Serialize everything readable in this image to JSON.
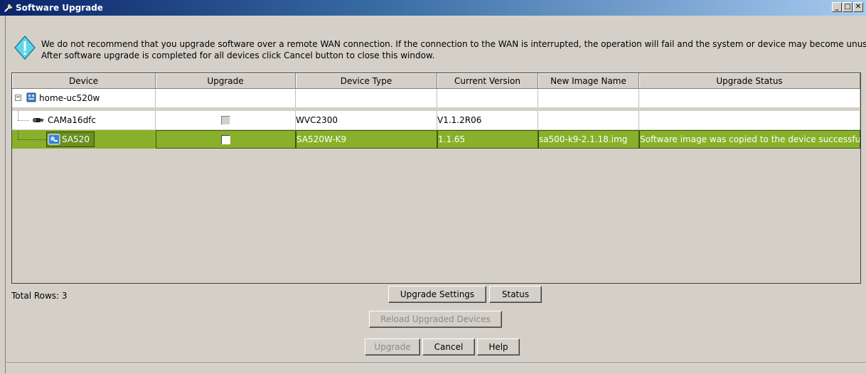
{
  "window": {
    "title": "Software Upgrade"
  },
  "warning": {
    "line1": "We do not recommend that you upgrade software over a remote WAN connection. If the connection to the WAN is interrupted, the operation will fail and the system or device may become unusable.",
    "line2": "After software upgrade is completed for all devices click Cancel button to close this window."
  },
  "table": {
    "columns": [
      "Device",
      "Upgrade",
      "Device Type",
      "Current Version",
      "New Image Name",
      "Upgrade Status"
    ],
    "rows": [
      {
        "device": "home-uc520w",
        "device_type": "",
        "current_version": "",
        "new_image": "",
        "status": ""
      },
      {
        "device": "CAMa16dfc",
        "device_type": "WVC2300",
        "current_version": "V1.1.2R06",
        "new_image": "",
        "status": ""
      },
      {
        "device": "SA520",
        "device_type": "SA520W-K9",
        "current_version": "1.1.65",
        "new_image": "sa500-k9-2.1.18.img",
        "status": "Software image was copied to the device successfully."
      }
    ]
  },
  "footer": {
    "total_rows": "Total Rows: 3",
    "upgrade_settings": "Upgrade Settings",
    "status": "Status",
    "reload": "Reload Upgraded Devices",
    "upgrade": "Upgrade",
    "cancel": "Cancel",
    "help": "Help"
  },
  "colors": {
    "selected_row": "#88b02a",
    "title_gradient_start": "#0a246a",
    "title_gradient_end": "#a6caf0"
  },
  "icons": [
    "wrench-icon",
    "minimize-icon",
    "maximize-icon",
    "close-icon",
    "warning-icon",
    "router-icon",
    "camera-icon",
    "firewall-icon"
  ]
}
